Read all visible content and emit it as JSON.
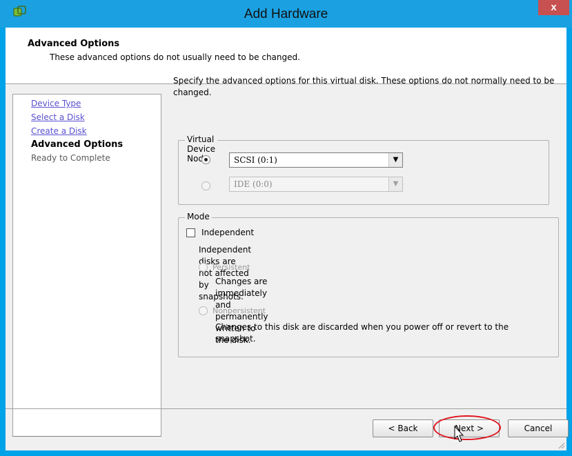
{
  "window": {
    "title": "Add Hardware",
    "close_glyph": "x"
  },
  "header": {
    "title": "Advanced Options",
    "subtitle": "These advanced options do not usually need to be changed."
  },
  "nav": {
    "items": [
      {
        "label": "Device Type",
        "state": "link"
      },
      {
        "label": "Select a Disk",
        "state": "link"
      },
      {
        "label": "Create a Disk",
        "state": "link"
      },
      {
        "label": "Advanced Options",
        "state": "current"
      },
      {
        "label": "Ready to Complete",
        "state": "disabled"
      }
    ]
  },
  "content": {
    "description": "Specify the advanced options for this virtual disk. These options do not normally need to be changed.",
    "virtual_device_node": {
      "legend": "Virtual Device Node",
      "scsi": {
        "value": "SCSI (0:1)",
        "selected": true
      },
      "ide": {
        "value": "IDE (0:0)",
        "selected": false
      }
    },
    "mode": {
      "legend": "Mode",
      "independent_label": "Independent",
      "independent_checked": false,
      "independent_note": "Independent disks are not affected by snapshots.",
      "persistent_label": "Persistent",
      "persistent_desc": "Changes are immediately and permanently written to the disk.",
      "nonpersistent_label": "Nonpersistent",
      "nonpersistent_desc": "Changes to this disk are discarded when you power off or revert to the snapshot."
    }
  },
  "buttons": {
    "back": "< Back",
    "next": "Next >",
    "cancel": "Cancel"
  },
  "colors": {
    "titlebar": "#1ba1e2",
    "link": "#5a4fd0",
    "highlight": "#e0141e"
  }
}
